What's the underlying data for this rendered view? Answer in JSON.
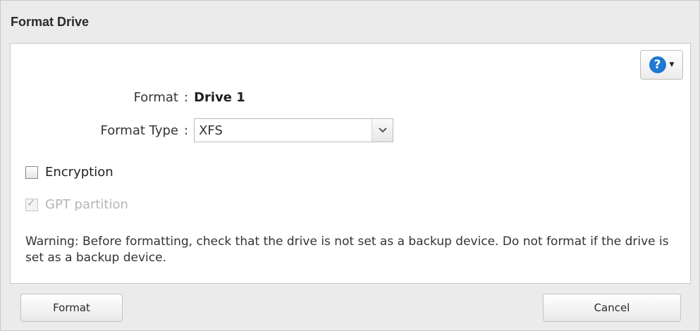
{
  "dialog": {
    "title": "Format Drive"
  },
  "help": {
    "glyph": "?",
    "accent_color": "#1f78d1"
  },
  "form": {
    "format_label": "Format",
    "format_value": "Drive 1",
    "format_type_label": "Format Type",
    "format_type_selected": "XFS",
    "colon": ":"
  },
  "options": {
    "encryption_label": "Encryption",
    "encryption_checked": false,
    "gpt_label": "GPT partition",
    "gpt_checked": true,
    "gpt_disabled": true
  },
  "warning": {
    "text": "Warning: Before formatting, check that the drive is not set as a backup device. Do not format if the drive is set as a backup device."
  },
  "buttons": {
    "format_label": "Format",
    "cancel_label": "Cancel"
  }
}
